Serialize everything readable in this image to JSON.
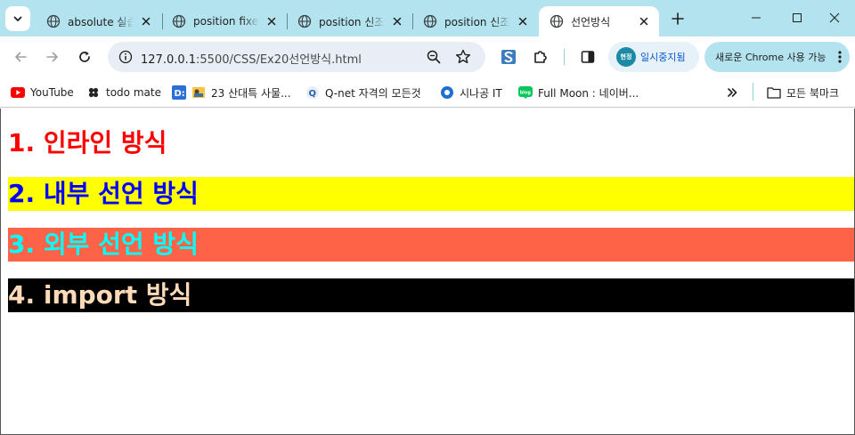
{
  "tabs": [
    {
      "title": "absolute 실습",
      "active": false
    },
    {
      "title": "position fixed",
      "active": false
    },
    {
      "title": "position 신조",
      "active": false
    },
    {
      "title": "position 신조",
      "active": false
    },
    {
      "title": "선언방식",
      "active": true
    }
  ],
  "toolbar": {
    "url_host": "127.0.0.1",
    "url_path": ":5500/CSS/Ex20선언방식.html",
    "profile_avatar": "현정",
    "profile_label": "일시중지됨",
    "update_label": "새로운 Chrome 사용 가능"
  },
  "bookmarks": [
    {
      "label": "YouTube",
      "icon": "youtube-icon"
    },
    {
      "label": "todo mate",
      "icon": "todomate-icon"
    },
    {
      "label": "",
      "icon": "d-icon"
    },
    {
      "label": "23 산대특 사물...",
      "icon": "folder-photo-icon"
    },
    {
      "label": "Q-net 자격의 모든것",
      "icon": "qnet-icon"
    },
    {
      "label": "시나공 IT",
      "icon": "sinagong-icon"
    },
    {
      "label": "Full Moon : 네이버...",
      "icon": "naver-blog-icon"
    }
  ],
  "bookmarks_all_label": "모든 북마크",
  "content": {
    "h1": "1. 인라인 방식",
    "h2": "2. 내부 선언 방식",
    "h3": "3. 외부 선언 방식",
    "h4": "4. import 방식"
  },
  "colors": {
    "tabstrip": "#b2e3ee",
    "h1_text": "#ff0000",
    "h2_text": "#0000ff",
    "h2_bg": "#ffff00",
    "h3_text": "#00ffff",
    "h3_bg": "#ff6347",
    "h4_text": "#ffdab9",
    "h4_bg": "#000000"
  }
}
